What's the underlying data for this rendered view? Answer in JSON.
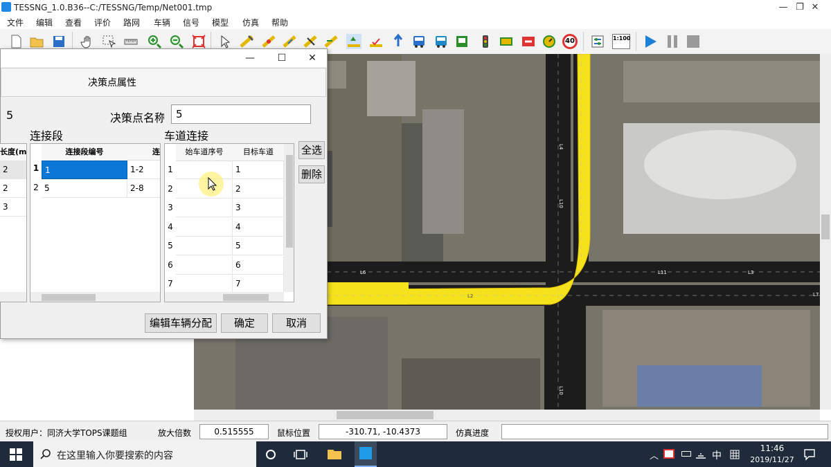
{
  "window": {
    "title": "TESSNG_1.0.B36--C:/TESSNG/Temp/Net001.tmp",
    "minimize": "—",
    "maximize": "❐",
    "close": "✕"
  },
  "menu": [
    "文件",
    "编辑",
    "查看",
    "评价",
    "路网",
    "车辆",
    "信号",
    "模型",
    "仿真",
    "帮助"
  ],
  "toolbar": {
    "scale_label": "1:100",
    "speed_limit": "40"
  },
  "dialog": {
    "close": "✕",
    "maximize": "☐",
    "header": "决策点属性",
    "id_value": "5",
    "name_label": "决策点名称",
    "name_value": "5",
    "left_table": {
      "header": "长度(m)",
      "rows": [
        "2",
        "2",
        "3"
      ]
    },
    "connector_section": {
      "title": "连接段",
      "col_id": "连接段编号",
      "col_conn": "连",
      "rows": [
        {
          "idx": "1",
          "id": "1",
          "conn": "1-2"
        },
        {
          "idx": "2",
          "id": "5",
          "conn": "2-8"
        }
      ]
    },
    "lane_section": {
      "title": "车道连接",
      "col_from": "始车道序号",
      "col_to": "目标车道",
      "rows": [
        {
          "idx": "1",
          "to": "1"
        },
        {
          "idx": "2",
          "to": "2"
        },
        {
          "idx": "3",
          "to": "3"
        },
        {
          "idx": "4",
          "to": "4"
        },
        {
          "idx": "5",
          "to": "5"
        },
        {
          "idx": "6",
          "to": "6"
        },
        {
          "idx": "7",
          "to": "7"
        }
      ]
    },
    "select_all": "全选",
    "delete": "删除",
    "edit_dist": "编辑车辆分配",
    "ok": "确定",
    "cancel": "取消"
  },
  "status": {
    "user_label": "授权用户：同济大学TOPS课题组",
    "zoom_label": "放大倍数",
    "zoom_value": "0.515555",
    "pos_label": "鼠标位置",
    "pos_value": "-310.71, -10.4373",
    "progress_label": "仿真进度"
  },
  "map": {
    "link_labels": [
      "L4",
      "L10",
      "L6",
      "L2",
      "L11",
      "L3",
      "L7",
      "L10"
    ]
  },
  "taskbar": {
    "search_placeholder": "在这里输入你要搜索的内容",
    "ime": "中",
    "time": "11:46",
    "date": "2019/11/27"
  }
}
